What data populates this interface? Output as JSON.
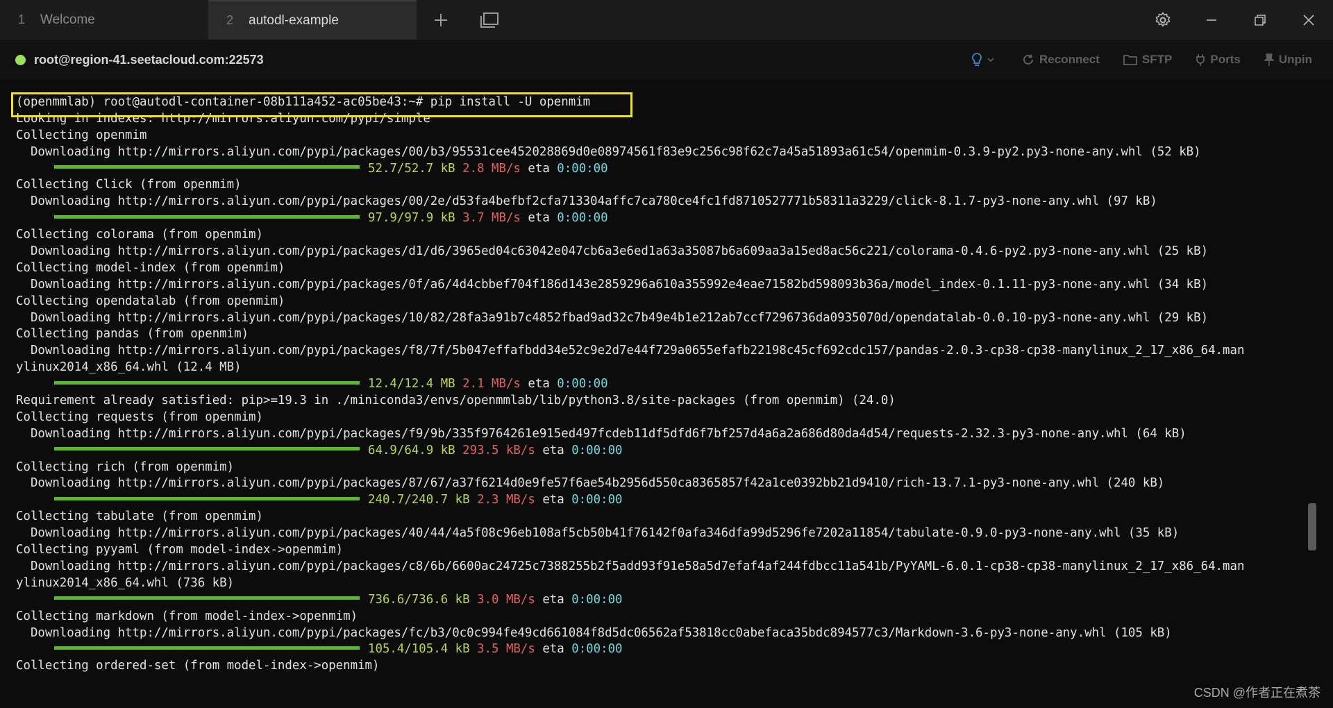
{
  "tabs": [
    {
      "num": "1",
      "label": "Welcome"
    },
    {
      "num": "2",
      "label": "autodl-example"
    }
  ],
  "tabbar": {
    "new_tab_glyph": "+"
  },
  "session": {
    "host": "root@region-41.seetacloud.com:22573",
    "status_color": "#9be05a",
    "tools": {
      "reconnect": "Reconnect",
      "sftp": "SFTP",
      "ports": "Ports",
      "unpin": "Unpin"
    }
  },
  "terminal": {
    "prompt": "(openmmlab) root@autodl-container-08b111a452-ac05be43:~# pip install -U openmim",
    "lines": [
      "Looking in indexes: http://mirrors.aliyun.com/pypi/simple",
      "Collecting openmim",
      "  Downloading http://mirrors.aliyun.com/pypi/packages/00/b3/95531cee452028869d0e08974561f83e9c256c98f62c7a45a51893a61c54/openmim-0.3.9-py2.py3-none-any.whl (52 kB)",
      "Collecting Click (from openmim)",
      "  Downloading http://mirrors.aliyun.com/pypi/packages/00/2e/d53fa4befbf2cfa713304affc7ca780ce4fc1fd8710527771b58311a3229/click-8.1.7-py3-none-any.whl (97 kB)",
      "Collecting colorama (from openmim)",
      "  Downloading http://mirrors.aliyun.com/pypi/packages/d1/d6/3965ed04c63042e047cb6a3e6ed1a63a35087b6a609aa3a15ed8ac56c221/colorama-0.4.6-py2.py3-none-any.whl (25 kB)",
      "Collecting model-index (from openmim)",
      "  Downloading http://mirrors.aliyun.com/pypi/packages/0f/a6/4d4cbbef704f186d143e2859296a610a355992e4eae71582bd598093b36a/model_index-0.1.11-py3-none-any.whl (34 kB)",
      "Collecting opendatalab (from openmim)",
      "  Downloading http://mirrors.aliyun.com/pypi/packages/10/82/28fa3a91b7c4852fbad9ad32c7b49e4b1e212ab7ccf7296736da0935070d/opendatalab-0.0.10-py3-none-any.whl (29 kB)",
      "Collecting pandas (from openmim)",
      "  Downloading http://mirrors.aliyun.com/pypi/packages/f8/7f/5b047effafbdd34e52c9e2d7e44f729a0655efafb22198c45cf692cdc157/pandas-2.0.3-cp38-cp38-manylinux_2_17_x86_64.man",
      "ylinux2014_x86_64.whl (12.4 MB)",
      "Requirement already satisfied: pip>=19.3 in ./miniconda3/envs/openmmlab/lib/python3.8/site-packages (from openmim) (24.0)",
      "Collecting requests (from openmim)",
      "  Downloading http://mirrors.aliyun.com/pypi/packages/f9/9b/335f9764261e915ed497fcdeb11df5dfd6f7bf257d4a6a2a686d80da4d54/requests-2.32.3-py3-none-any.whl (64 kB)",
      "Collecting rich (from openmim)",
      "  Downloading http://mirrors.aliyun.com/pypi/packages/87/67/a37f6214d0e9fe57f6ae54b2956d550ca8365857f42a1ce0392bb21d9410/rich-13.7.1-py3-none-any.whl (240 kB)",
      "Collecting tabulate (from openmim)",
      "  Downloading http://mirrors.aliyun.com/pypi/packages/40/44/4a5f08c96eb108af5cb50b41f76142f0afa346dfa99d5296fe7202a11854/tabulate-0.9.0-py3-none-any.whl (35 kB)",
      "Collecting pyyaml (from model-index->openmim)",
      "  Downloading http://mirrors.aliyun.com/pypi/packages/c8/6b/6600ac24725c7388255b2f5add93f91e58a5d7efaf4af244fdbcc11a541b/PyYAML-6.0.1-cp38-cp38-manylinux_2_17_x86_64.man",
      "ylinux2014_x86_64.whl (736 kB)",
      "Collecting markdown (from model-index->openmim)",
      "  Downloading http://mirrors.aliyun.com/pypi/packages/fc/b3/0c0c994fe49cd661084f8d5dc06562af53818cc0abefaca35bdc894577c3/Markdown-3.6-py3-none-any.whl (105 kB)",
      "Collecting ordered-set (from model-index->openmim)"
    ],
    "progress": [
      {
        "size": "52.7/52.7 kB",
        "speed": "2.8 MB/s",
        "eta_label": "eta",
        "eta": "0:00:00",
        "fraction": 1.0
      },
      {
        "size": "97.9/97.9 kB",
        "speed": "3.7 MB/s",
        "eta_label": "eta",
        "eta": "0:00:00",
        "fraction": 1.0
      },
      {
        "size": "12.4/12.4 MB",
        "speed": "2.1 MB/s",
        "eta_label": "eta",
        "eta": "0:00:00",
        "fraction": 1.0
      },
      {
        "size": "64.9/64.9 kB",
        "speed": "293.5 kB/s",
        "eta_label": "eta",
        "eta": "0:00:00",
        "fraction": 1.0
      },
      {
        "size": "240.7/240.7 kB",
        "speed": "2.3 MB/s",
        "eta_label": "eta",
        "eta": "0:00:00",
        "fraction": 1.0
      },
      {
        "size": "736.6/736.6 kB",
        "speed": "3.0 MB/s",
        "eta_label": "eta",
        "eta": "0:00:00",
        "fraction": 1.0
      },
      {
        "size": "105.4/105.4 kB",
        "speed": "3.5 MB/s",
        "eta_label": "eta",
        "eta": "0:00:00",
        "fraction": 1.0
      }
    ]
  },
  "watermark": "CSDN @作者正在煮茶",
  "colors": {
    "highlight_box": "#f2e21b",
    "progress_bar": "#5cb82c",
    "size_text": "#b5d94a",
    "speed_text": "#e0605c",
    "eta_text": "#6fd8dc"
  }
}
